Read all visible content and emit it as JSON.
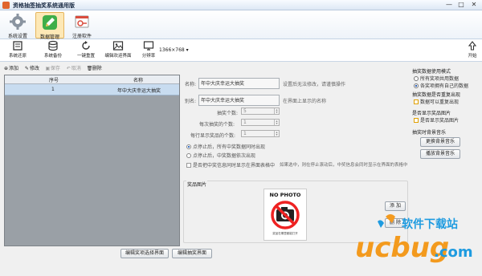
{
  "window": {
    "title": "资格抽签抽奖系统通用版",
    "minimize": "—",
    "maximize": "□",
    "close": "✕"
  },
  "ribbon": {
    "tabs": [
      {
        "label": "系统设置",
        "icon": "gear-icon"
      },
      {
        "label": "数据管理",
        "icon": "pencil-icon",
        "active": true
      },
      {
        "label": "注册软件",
        "icon": "key-icon"
      }
    ]
  },
  "toolbar": {
    "buttons": [
      {
        "label": "系统还原",
        "icon": "restore-icon"
      },
      {
        "label": "系统备份",
        "icon": "database-icon"
      },
      {
        "label": "一键重置",
        "icon": "refresh-icon"
      },
      {
        "label": "编辑欢迎界面",
        "icon": "image-icon"
      },
      {
        "label": "分辨率",
        "icon": "monitor-icon"
      }
    ],
    "resolution": "1366×768",
    "start_label": "开始"
  },
  "actions": {
    "add": "添加",
    "edit": "修改",
    "save": "保存",
    "cancel": "取消",
    "delete": "删除"
  },
  "grid": {
    "columns": [
      "序号",
      "名称"
    ],
    "rows": [
      {
        "index": "1",
        "name": "年中大庆幸运大抽奖"
      }
    ]
  },
  "form": {
    "name_label": "名称:",
    "name_value": "年中大庆幸运大抽奖",
    "name_hint": "设置后无法修改，请谨慎操作",
    "alias_label": "别名:",
    "alias_value": "年中大庆幸运大抽奖",
    "alias_hint": "在界面上显示的名称",
    "draw_count_label": "抽奖个数:",
    "draw_count_value": "5",
    "each_draw_label": "每次抽奖的个数:",
    "each_draw_value": "1",
    "display_each_label": "每行显示奖品的个数:",
    "display_each_value": "1",
    "radio1": "点停止后，所有中奖数据同时出现",
    "radio2": "点停止后，中奖数据依次出现",
    "checkbox_label": "是否把中奖信息同时显示在界面表格中",
    "checkbox_hint": "如果选中，则在停止滚动后，中奖信息会同时显示在界面的表格中"
  },
  "photo": {
    "legend": "奖品图片",
    "placeholder": "NO PHOTO",
    "caption": "奖品在哪里都能打开",
    "add_button": "添 加",
    "delete_button": "删 除"
  },
  "bottom_buttons": {
    "edit_select": "编辑奖项选择界面",
    "edit_draw": "编辑抽奖界面"
  },
  "side": {
    "mode_title": "抽奖数据使用模式",
    "mode_opt1": "所有奖项共用数据",
    "mode_opt2": "各奖项拥有自己的数据",
    "repeat_title": "抽奖数据是否重复出现",
    "repeat_opt": "数据可以重复出现",
    "show_photo_title": "是否显示奖品图片",
    "show_photo_opt": "是否显示奖品图片",
    "music_title": "抽奖时背景音乐",
    "change_music": "更换背景音乐",
    "play_music": "播放背景音乐"
  },
  "watermark": {
    "brand": "ucbug",
    "tld": ".com",
    "slogan": "软件下载站"
  },
  "colors": {
    "accent": "#f08a1c",
    "selected_row": "#c8dcf0",
    "brand_orange": "#f39a1e",
    "brand_blue": "#1e9be0"
  }
}
